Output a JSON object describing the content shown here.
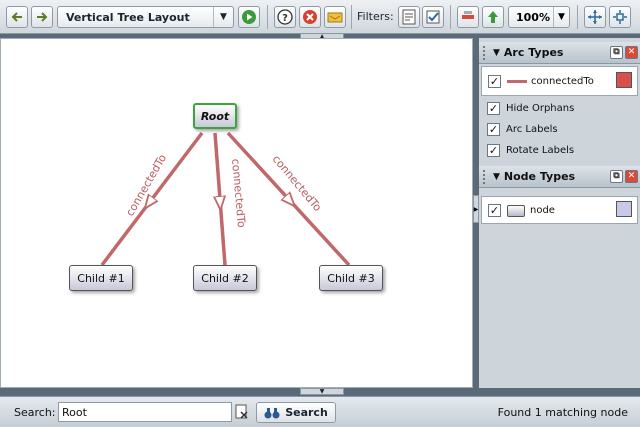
{
  "toolbar": {
    "layout": "Vertical Tree Layout",
    "filters_label": "Filters:",
    "zoom": "100%"
  },
  "graph": {
    "root": "Root",
    "children": [
      "Child #1",
      "Child #2",
      "Child #3"
    ],
    "edge_label": "connectedTo",
    "edge_color": "#c0686a",
    "root_border_color": "#3aa63a"
  },
  "panel": {
    "arc_types": {
      "title": "Arc Types",
      "items": [
        {
          "label": "connectedTo",
          "checked": "✓",
          "color": "#d8504a"
        }
      ],
      "options": [
        {
          "label": "Hide Orphans",
          "checked": "✓"
        },
        {
          "label": "Arc Labels",
          "checked": "✓"
        },
        {
          "label": "Rotate Labels",
          "checked": "✓"
        }
      ]
    },
    "node_types": {
      "title": "Node Types",
      "items": [
        {
          "label": "node",
          "checked": "✓",
          "color": "#c8c8e8"
        }
      ]
    }
  },
  "search": {
    "label": "Search:",
    "value": "Root",
    "button": "Search",
    "status": "Found 1 matching node"
  }
}
